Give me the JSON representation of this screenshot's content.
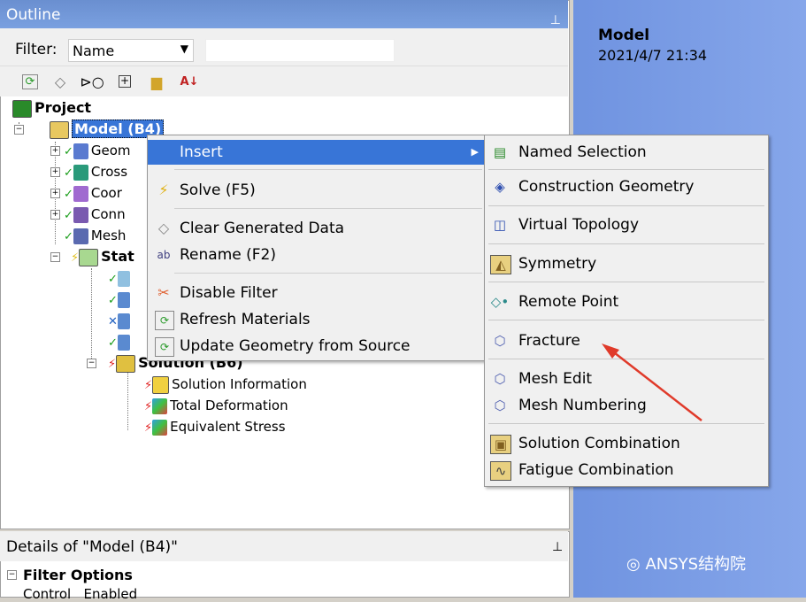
{
  "outline": {
    "title": "Outline",
    "pin": "📌",
    "filter_label": "Filter:",
    "filter_value": "Name",
    "filter_text": ""
  },
  "tree": {
    "project": "Project",
    "model": "Model (B4)",
    "geometry": "Geom",
    "cross": "Cross",
    "coord": "Coor",
    "conn": "Conn",
    "mesh": "Mesh",
    "static": "Stat",
    "solution": "Solution (B6)",
    "solution_info": "Solution Information",
    "total_def": "Total Deformation",
    "equiv_stress": "Equivalent Stress"
  },
  "context_menu": {
    "insert": "Insert",
    "solve": "Solve (F5)",
    "clear": "Clear Generated Data",
    "rename": "Rename (F2)",
    "disable_filter": "Disable Filter",
    "refresh": "Refresh Materials",
    "update_geom": "Update Geometry from Source"
  },
  "submenu": {
    "named_selection": "Named Selection",
    "construction_geometry": "Construction Geometry",
    "virtual_topology": "Virtual Topology",
    "symmetry": "Symmetry",
    "remote_point": "Remote Point",
    "fracture": "Fracture",
    "mesh_edit": "Mesh Edit",
    "mesh_numbering": "Mesh Numbering",
    "solution_combination": "Solution Combination",
    "fatigue_combination": "Fatigue Combination"
  },
  "right_panel": {
    "title": "Model",
    "date": "2021/4/7 21:34",
    "watermark": "ANSYS结构院"
  },
  "details": {
    "title": "Details of \"Model (B4)\"",
    "filter_options": "Filter Options",
    "control": "Control",
    "enabled": "Enabled"
  },
  "colors": {
    "highlight": "#3875d7",
    "title_bar": "#7aa0e0",
    "arrow": "#e03a2a"
  }
}
